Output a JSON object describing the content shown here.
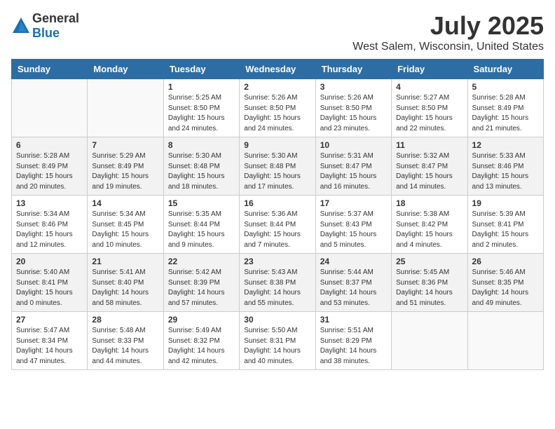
{
  "logo": {
    "general": "General",
    "blue": "Blue"
  },
  "title": "July 2025",
  "location": "West Salem, Wisconsin, United States",
  "days_of_week": [
    "Sunday",
    "Monday",
    "Tuesday",
    "Wednesday",
    "Thursday",
    "Friday",
    "Saturday"
  ],
  "weeks": [
    [
      {
        "day": "",
        "info": ""
      },
      {
        "day": "",
        "info": ""
      },
      {
        "day": "1",
        "info": "Sunrise: 5:25 AM\nSunset: 8:50 PM\nDaylight: 15 hours\nand 24 minutes."
      },
      {
        "day": "2",
        "info": "Sunrise: 5:26 AM\nSunset: 8:50 PM\nDaylight: 15 hours\nand 24 minutes."
      },
      {
        "day": "3",
        "info": "Sunrise: 5:26 AM\nSunset: 8:50 PM\nDaylight: 15 hours\nand 23 minutes."
      },
      {
        "day": "4",
        "info": "Sunrise: 5:27 AM\nSunset: 8:50 PM\nDaylight: 15 hours\nand 22 minutes."
      },
      {
        "day": "5",
        "info": "Sunrise: 5:28 AM\nSunset: 8:49 PM\nDaylight: 15 hours\nand 21 minutes."
      }
    ],
    [
      {
        "day": "6",
        "info": "Sunrise: 5:28 AM\nSunset: 8:49 PM\nDaylight: 15 hours\nand 20 minutes."
      },
      {
        "day": "7",
        "info": "Sunrise: 5:29 AM\nSunset: 8:49 PM\nDaylight: 15 hours\nand 19 minutes."
      },
      {
        "day": "8",
        "info": "Sunrise: 5:30 AM\nSunset: 8:48 PM\nDaylight: 15 hours\nand 18 minutes."
      },
      {
        "day": "9",
        "info": "Sunrise: 5:30 AM\nSunset: 8:48 PM\nDaylight: 15 hours\nand 17 minutes."
      },
      {
        "day": "10",
        "info": "Sunrise: 5:31 AM\nSunset: 8:47 PM\nDaylight: 15 hours\nand 16 minutes."
      },
      {
        "day": "11",
        "info": "Sunrise: 5:32 AM\nSunset: 8:47 PM\nDaylight: 15 hours\nand 14 minutes."
      },
      {
        "day": "12",
        "info": "Sunrise: 5:33 AM\nSunset: 8:46 PM\nDaylight: 15 hours\nand 13 minutes."
      }
    ],
    [
      {
        "day": "13",
        "info": "Sunrise: 5:34 AM\nSunset: 8:46 PM\nDaylight: 15 hours\nand 12 minutes."
      },
      {
        "day": "14",
        "info": "Sunrise: 5:34 AM\nSunset: 8:45 PM\nDaylight: 15 hours\nand 10 minutes."
      },
      {
        "day": "15",
        "info": "Sunrise: 5:35 AM\nSunset: 8:44 PM\nDaylight: 15 hours\nand 9 minutes."
      },
      {
        "day": "16",
        "info": "Sunrise: 5:36 AM\nSunset: 8:44 PM\nDaylight: 15 hours\nand 7 minutes."
      },
      {
        "day": "17",
        "info": "Sunrise: 5:37 AM\nSunset: 8:43 PM\nDaylight: 15 hours\nand 5 minutes."
      },
      {
        "day": "18",
        "info": "Sunrise: 5:38 AM\nSunset: 8:42 PM\nDaylight: 15 hours\nand 4 minutes."
      },
      {
        "day": "19",
        "info": "Sunrise: 5:39 AM\nSunset: 8:41 PM\nDaylight: 15 hours\nand 2 minutes."
      }
    ],
    [
      {
        "day": "20",
        "info": "Sunrise: 5:40 AM\nSunset: 8:41 PM\nDaylight: 15 hours\nand 0 minutes."
      },
      {
        "day": "21",
        "info": "Sunrise: 5:41 AM\nSunset: 8:40 PM\nDaylight: 14 hours\nand 58 minutes."
      },
      {
        "day": "22",
        "info": "Sunrise: 5:42 AM\nSunset: 8:39 PM\nDaylight: 14 hours\nand 57 minutes."
      },
      {
        "day": "23",
        "info": "Sunrise: 5:43 AM\nSunset: 8:38 PM\nDaylight: 14 hours\nand 55 minutes."
      },
      {
        "day": "24",
        "info": "Sunrise: 5:44 AM\nSunset: 8:37 PM\nDaylight: 14 hours\nand 53 minutes."
      },
      {
        "day": "25",
        "info": "Sunrise: 5:45 AM\nSunset: 8:36 PM\nDaylight: 14 hours\nand 51 minutes."
      },
      {
        "day": "26",
        "info": "Sunrise: 5:46 AM\nSunset: 8:35 PM\nDaylight: 14 hours\nand 49 minutes."
      }
    ],
    [
      {
        "day": "27",
        "info": "Sunrise: 5:47 AM\nSunset: 8:34 PM\nDaylight: 14 hours\nand 47 minutes."
      },
      {
        "day": "28",
        "info": "Sunrise: 5:48 AM\nSunset: 8:33 PM\nDaylight: 14 hours\nand 44 minutes."
      },
      {
        "day": "29",
        "info": "Sunrise: 5:49 AM\nSunset: 8:32 PM\nDaylight: 14 hours\nand 42 minutes."
      },
      {
        "day": "30",
        "info": "Sunrise: 5:50 AM\nSunset: 8:31 PM\nDaylight: 14 hours\nand 40 minutes."
      },
      {
        "day": "31",
        "info": "Sunrise: 5:51 AM\nSunset: 8:29 PM\nDaylight: 14 hours\nand 38 minutes."
      },
      {
        "day": "",
        "info": ""
      },
      {
        "day": "",
        "info": ""
      }
    ]
  ]
}
